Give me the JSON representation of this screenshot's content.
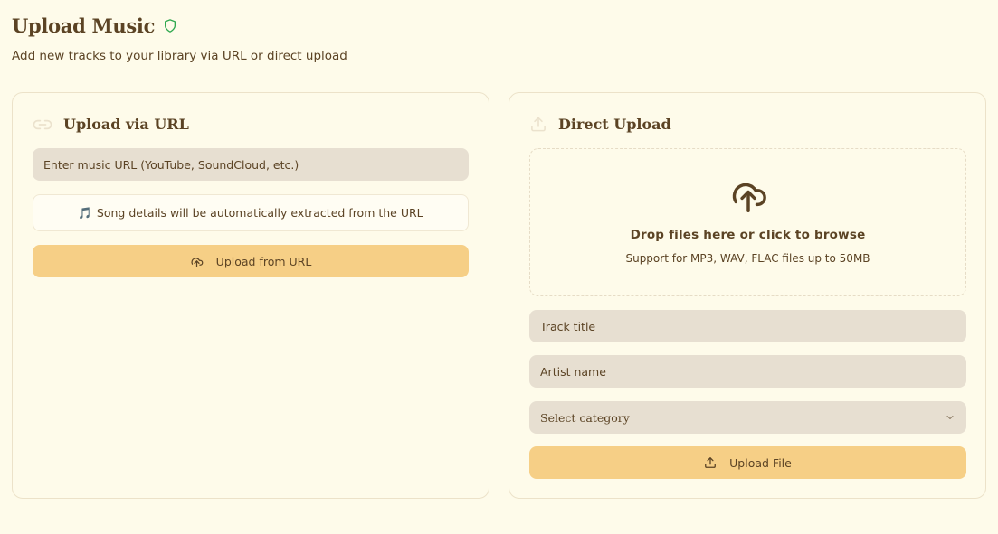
{
  "header": {
    "title": "Upload Music",
    "subtitle": "Add new tracks to your library via URL or direct upload",
    "title_icon": "shield-icon"
  },
  "url_card": {
    "title": "Upload via URL",
    "icon": "link-icon",
    "url_input_placeholder": "Enter music URL (YouTube, SoundCloud, etc.)",
    "info_emoji": "🎵",
    "info_text": "Song details will be automatically extracted from the URL",
    "button_label": "Upload from URL",
    "button_icon": "cloud-upload-icon"
  },
  "direct_card": {
    "title": "Direct Upload",
    "icon": "upload-icon",
    "dropzone": {
      "icon": "cloud-upload-icon",
      "title": "Drop files here or click to browse",
      "subtitle": "Support for MP3, WAV, FLAC files up to 50MB"
    },
    "track_title_placeholder": "Track title",
    "artist_name_placeholder": "Artist name",
    "category_select_value": "Select category",
    "button_label": "Upload File",
    "button_icon": "upload-icon"
  },
  "colors": {
    "background": "#fefbea",
    "text": "#5b4324",
    "input_bg": "#e7dfd1",
    "button_bg": "#f6cf86",
    "shield_green": "#2fa84f",
    "card_border": "#ece2c9"
  }
}
